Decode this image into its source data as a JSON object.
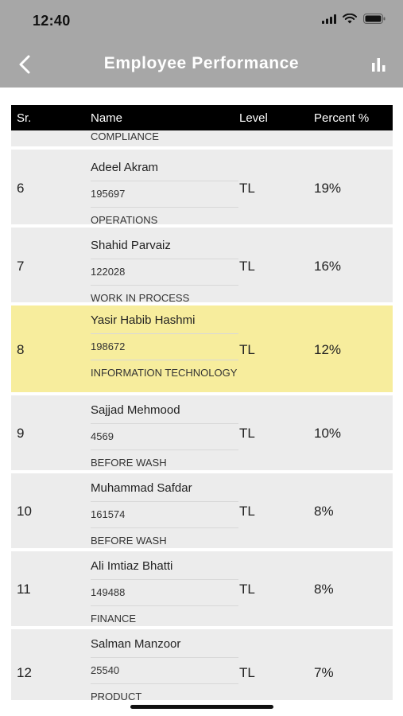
{
  "status_bar": {
    "time": "12:40"
  },
  "nav": {
    "title": "Employee Performance"
  },
  "table": {
    "headers": {
      "sr": "Sr.",
      "name": "Name",
      "level": "Level",
      "percent": "Percent %"
    },
    "partial_row": {
      "department": "COMPLIANCE"
    },
    "rows": [
      {
        "sr": "6",
        "name": "Adeel Akram",
        "id": "195697",
        "department": "OPERATIONS",
        "level": "TL",
        "percent": "19%"
      },
      {
        "sr": "7",
        "name": "Shahid Parvaiz",
        "id": "122028",
        "department": "WORK IN PROCESS",
        "level": "TL",
        "percent": "16%"
      },
      {
        "sr": "8",
        "name": "Yasir Habib Hashmi",
        "id": "198672",
        "department": "INFORMATION TECHNOLOGY",
        "level": "TL",
        "percent": "12%",
        "highlighted": true
      },
      {
        "sr": "9",
        "name": "Sajjad Mehmood",
        "id": "4569",
        "department": "BEFORE WASH",
        "level": "TL",
        "percent": "10%"
      },
      {
        "sr": "10",
        "name": "Muhammad Safdar",
        "id": "161574",
        "department": "BEFORE WASH",
        "level": "TL",
        "percent": "8%"
      },
      {
        "sr": "11",
        "name": "Ali Imtiaz Bhatti",
        "id": "149488",
        "department": "FINANCE",
        "level": "TL",
        "percent": "8%"
      },
      {
        "sr": "12",
        "name": "Salman Manzoor",
        "id": "25540",
        "department": "PRODUCT",
        "level": "TL",
        "percent": "7%"
      }
    ]
  },
  "colors": {
    "header_bg": "#a7a7a7",
    "row_bg": "#ececec",
    "highlight_bg": "#f7ed9d",
    "table_head_bg": "#000000"
  },
  "icons": {
    "back": "chevron-left-icon",
    "chart": "bar-chart-icon",
    "signal": "signal-icon",
    "wifi": "wifi-icon",
    "battery": "battery-icon"
  }
}
